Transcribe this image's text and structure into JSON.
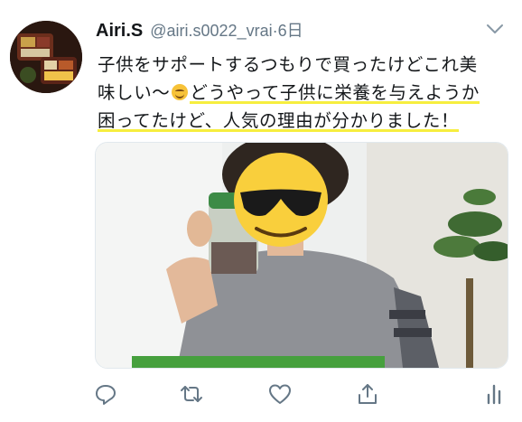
{
  "tweet": {
    "author_name": "Airi.S",
    "handle_time": "@airi.s0022_vrai·6日",
    "text_line1": "子供をサポートするつもりで買ったけどこれ美",
    "text_line2a": "味しい〜",
    "text_line2b": "どうやって子供に栄養を与えようか",
    "text_line3": "困ってたけど、人気の理由が分かりました！",
    "emoji": "smiling-face-emoji",
    "highlight_color": "#f6ee3f"
  },
  "icons": {
    "menu": "chevron-down-icon",
    "reply": "reply-icon",
    "retweet": "retweet-icon",
    "like": "heart-icon",
    "share": "share-icon",
    "analytics": "analytics-icon"
  },
  "colors": {
    "icon": "#657786",
    "text": "#14171a"
  }
}
